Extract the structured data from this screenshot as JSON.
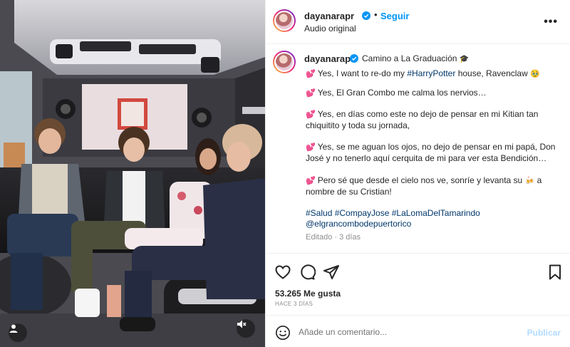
{
  "post": {
    "username": "dayanarapr",
    "follow_label": "Seguir",
    "dot_separator": "•",
    "audio_label": "Audio original",
    "more_label": "•••"
  },
  "caption": {
    "first_line": "Camino a La Graduación",
    "lines": [
      {
        "heart": "💕",
        "pre": "Yes, I want to re-do my ",
        "tag": "#HarryPotter",
        "post": " house, Ravenclaw",
        "emoji": "🥹"
      },
      {
        "heart": "💕",
        "pre": "Yes, El Gran Combo me calma los nervios…"
      },
      {
        "heart": "💕",
        "pre": "Yes, en días como este no dejo de pensar en mi Kitian tan"
      },
      {
        "pre": "chiquitito y toda su jornada,"
      },
      {
        "heart": "💕",
        "pre": "Yes, se me aguan los ojos, no dejo de pensar en mi papá, Don"
      },
      {
        "pre": "José y no tenerlo aquí cerquita de mi para ver esta Bendición…"
      },
      {
        "heart": "💕",
        "pre": "Pero sé que desde el cielo nos ve, sonríe y levanta su ",
        "emoji": "🍻",
        "post": " a"
      },
      {
        "pre": "nombre de su Cristian!"
      }
    ],
    "hashtags": "#Salud #CompayJose #LaLomaDelTamarindo",
    "mention": "@elgrancombodepuertorico",
    "edited": "Editado · 3 días"
  },
  "engagement": {
    "likes": "53.265 Me gusta",
    "date": "HACE 3 DÍAS"
  },
  "comment": {
    "placeholder": "Añade un comentario...",
    "publish_label": "Publicar"
  },
  "icons": {
    "verified": "verified-badge-icon",
    "like": "heart-icon",
    "comment": "comment-bubble-icon",
    "share": "send-icon",
    "save": "bookmark-icon",
    "emoji": "smiley-icon",
    "tagged_user": "user-icon",
    "mute": "muted-speaker-icon"
  },
  "colors": {
    "accent": "#0095f6",
    "link": "#00376b",
    "muted": "#8e8e8e",
    "publish_disabled": "#b3dbff"
  }
}
